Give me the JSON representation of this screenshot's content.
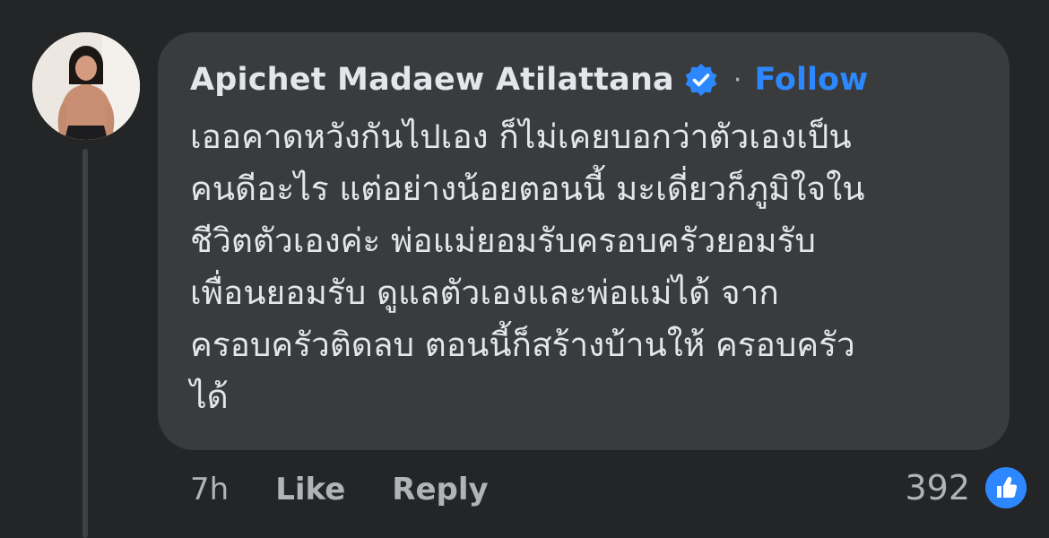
{
  "comment": {
    "author": "Apichet Madaew Atilattana",
    "separator": "·",
    "follow_label": "Follow",
    "verified_icon": "verified-badge-icon",
    "body_lines": [
      "เออคาดหวังกันไปเอง ก็ไม่เคยบอกว่าตัวเองเป็น",
      "คนดีอะไร แต่อย่างน้อยตอนนี้  มะเดี่ยวก็ภูมิใจใน",
      "ชีวิตตัวเองค่ะ  พ่อแม่ยอมรับครอบครัวยอมรับ",
      "เพื่อนยอมรับ  ดูแลตัวเองและพ่อแม่ได้  จาก",
      "ครอบครัวติดลบ ตอนนี้ก็สร้างบ้านให้ ครอบครัว",
      "ได้"
    ]
  },
  "actions": {
    "time": "7h",
    "like_label": "Like",
    "reply_label": "Reply"
  },
  "reactions": {
    "count": "392",
    "icon": "like-reaction-icon"
  },
  "colors": {
    "background": "#242526",
    "bubble": "#3a3b3c",
    "accent": "#2d88ff",
    "text_primary": "#e4e6eb",
    "text_secondary": "#b0b3b8"
  }
}
